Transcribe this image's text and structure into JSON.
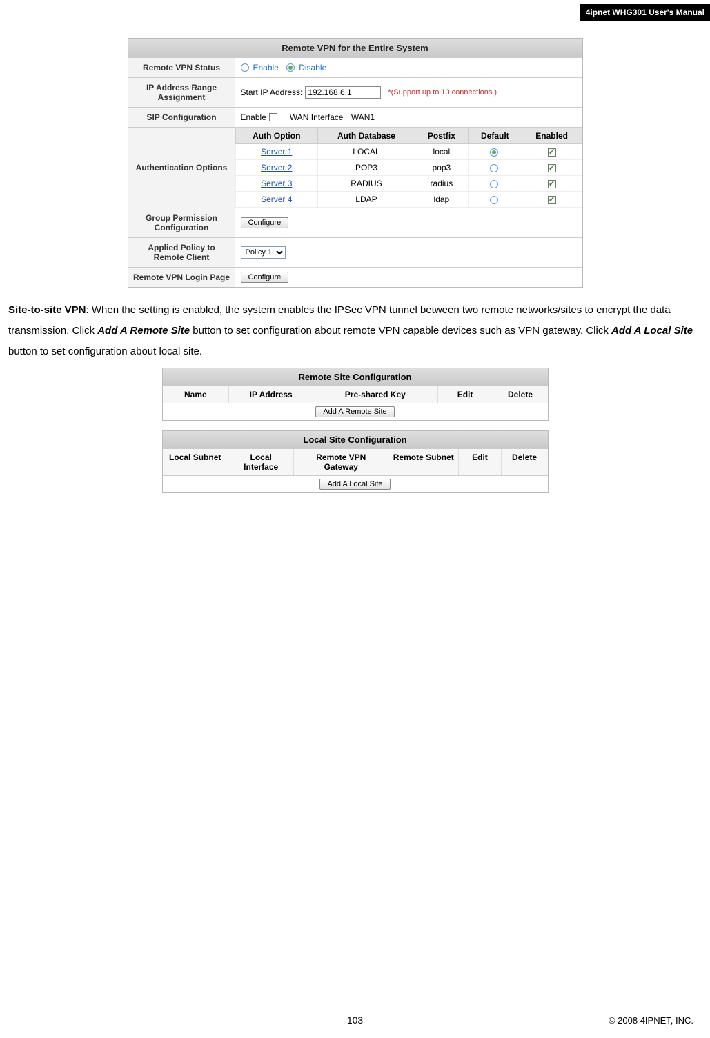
{
  "header": {
    "title": "4ipnet WHG301 User's Manual"
  },
  "remote_vpn": {
    "title": "Remote VPN for the Entire System",
    "rows": {
      "status_label": "Remote VPN Status",
      "status_enable": "Enable",
      "status_disable": "Disable",
      "ip_label": "IP Address Range Assignment",
      "ip_prefix": "Start IP Address:",
      "ip_value": "192.168.6.1",
      "ip_note": "*(Support up to 10 connections.)",
      "sip_label": "SIP Configuration",
      "sip_enable": "Enable",
      "sip_wan_label": "WAN Interface",
      "sip_wan_value": "WAN1",
      "auth_label": "Authentication Options",
      "group_label": "Group Permission Configuration",
      "group_btn": "Configure",
      "policy_label": "Applied Policy to Remote Client",
      "policy_value": "Policy 1",
      "login_label": "Remote VPN Login Page",
      "login_btn": "Configure"
    },
    "auth_headers": {
      "opt": "Auth Option",
      "db": "Auth Database",
      "post": "Postfix",
      "def": "Default",
      "en": "Enabled"
    },
    "auth_rows": [
      {
        "opt": "Server 1",
        "db": "LOCAL",
        "post": "local",
        "def": true,
        "en": true
      },
      {
        "opt": "Server 2",
        "db": "POP3",
        "post": "pop3",
        "def": false,
        "en": true
      },
      {
        "opt": "Server 3",
        "db": "RADIUS",
        "post": "radius",
        "def": false,
        "en": true
      },
      {
        "opt": "Server 4",
        "db": "LDAP",
        "post": "ldap",
        "def": false,
        "en": true
      }
    ]
  },
  "paragraph": {
    "lead": "Site-to-site VPN",
    "text1": ": When the setting is enabled, the system enables the IPSec VPN tunnel between two remote networks/sites to encrypt the data transmission. Click ",
    "btn1": "Add A Remote Site",
    "text2": " button to set configuration about remote VPN capable devices such as VPN gateway. Click ",
    "btn2": "Add A Local Site",
    "text3": " button to set configuration about local site."
  },
  "remote_site": {
    "title": "Remote Site Configuration",
    "cols": {
      "name": "Name",
      "ip": "IP Address",
      "psk": "Pre-shared Key",
      "edit": "Edit",
      "del": "Delete"
    },
    "add_btn": "Add A Remote Site"
  },
  "local_site": {
    "title": "Local Site Configuration",
    "cols": {
      "sub": "Local Subnet",
      "if": "Local Interface",
      "gw": "Remote VPN Gateway",
      "rs": "Remote Subnet",
      "edit": "Edit",
      "del": "Delete"
    },
    "add_btn": "Add A Local Site"
  },
  "footer": {
    "page": "103",
    "copy": "© 2008 4IPNET, INC."
  }
}
